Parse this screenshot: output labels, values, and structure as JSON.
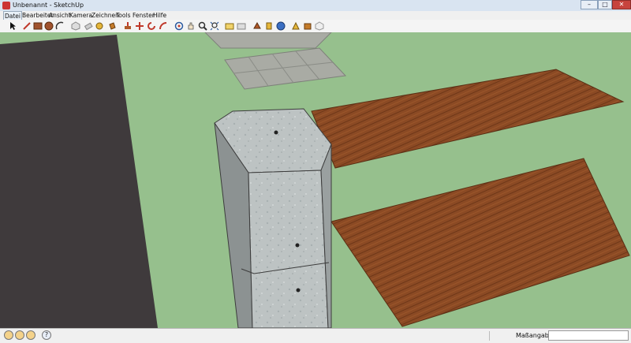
{
  "window": {
    "title": "Unbenannt - SketchUp",
    "controls": {
      "minimize": "–",
      "maximize": "□",
      "close": "✕"
    }
  },
  "menu": {
    "items": [
      {
        "label": "Datei"
      },
      {
        "label": "Bearbeiten"
      },
      {
        "label": "Ansicht"
      },
      {
        "label": "Kamera"
      },
      {
        "label": "Zeichnen"
      },
      {
        "label": "Tools"
      },
      {
        "label": "Fenster"
      },
      {
        "label": "Hilfe"
      }
    ],
    "active": "Datei"
  },
  "toolbar": {
    "tools": [
      "select-icon",
      "line-icon",
      "rectangle-icon",
      "circle-icon",
      "arc-icon",
      "make-component-icon",
      "eraser-icon",
      "tape-measure-icon",
      "paint-bucket-icon",
      "push-pull-icon",
      "move-icon",
      "rotate-icon",
      "offset-icon",
      "orbit-icon",
      "pan-icon",
      "zoom-icon",
      "zoom-extents-icon",
      "previous-view-icon",
      "next-view-icon",
      "top-view-icon",
      "iso-view-icon",
      "front-view-icon",
      "right-view-icon",
      "back-view-icon",
      "get-models-icon"
    ]
  },
  "colors": {
    "ground": "#96c08d",
    "dark_wall": "#3f3a3c",
    "wood": "#8b4a24",
    "concrete": "#b9bfbf",
    "paving": "#a9aba4"
  },
  "status": {
    "buttons": [
      "geo-location-icon",
      "credits-icon",
      "user-icon",
      "help-icon"
    ],
    "help_label": "?",
    "measurement_label": "Maßangaben",
    "measurement_value": ""
  }
}
